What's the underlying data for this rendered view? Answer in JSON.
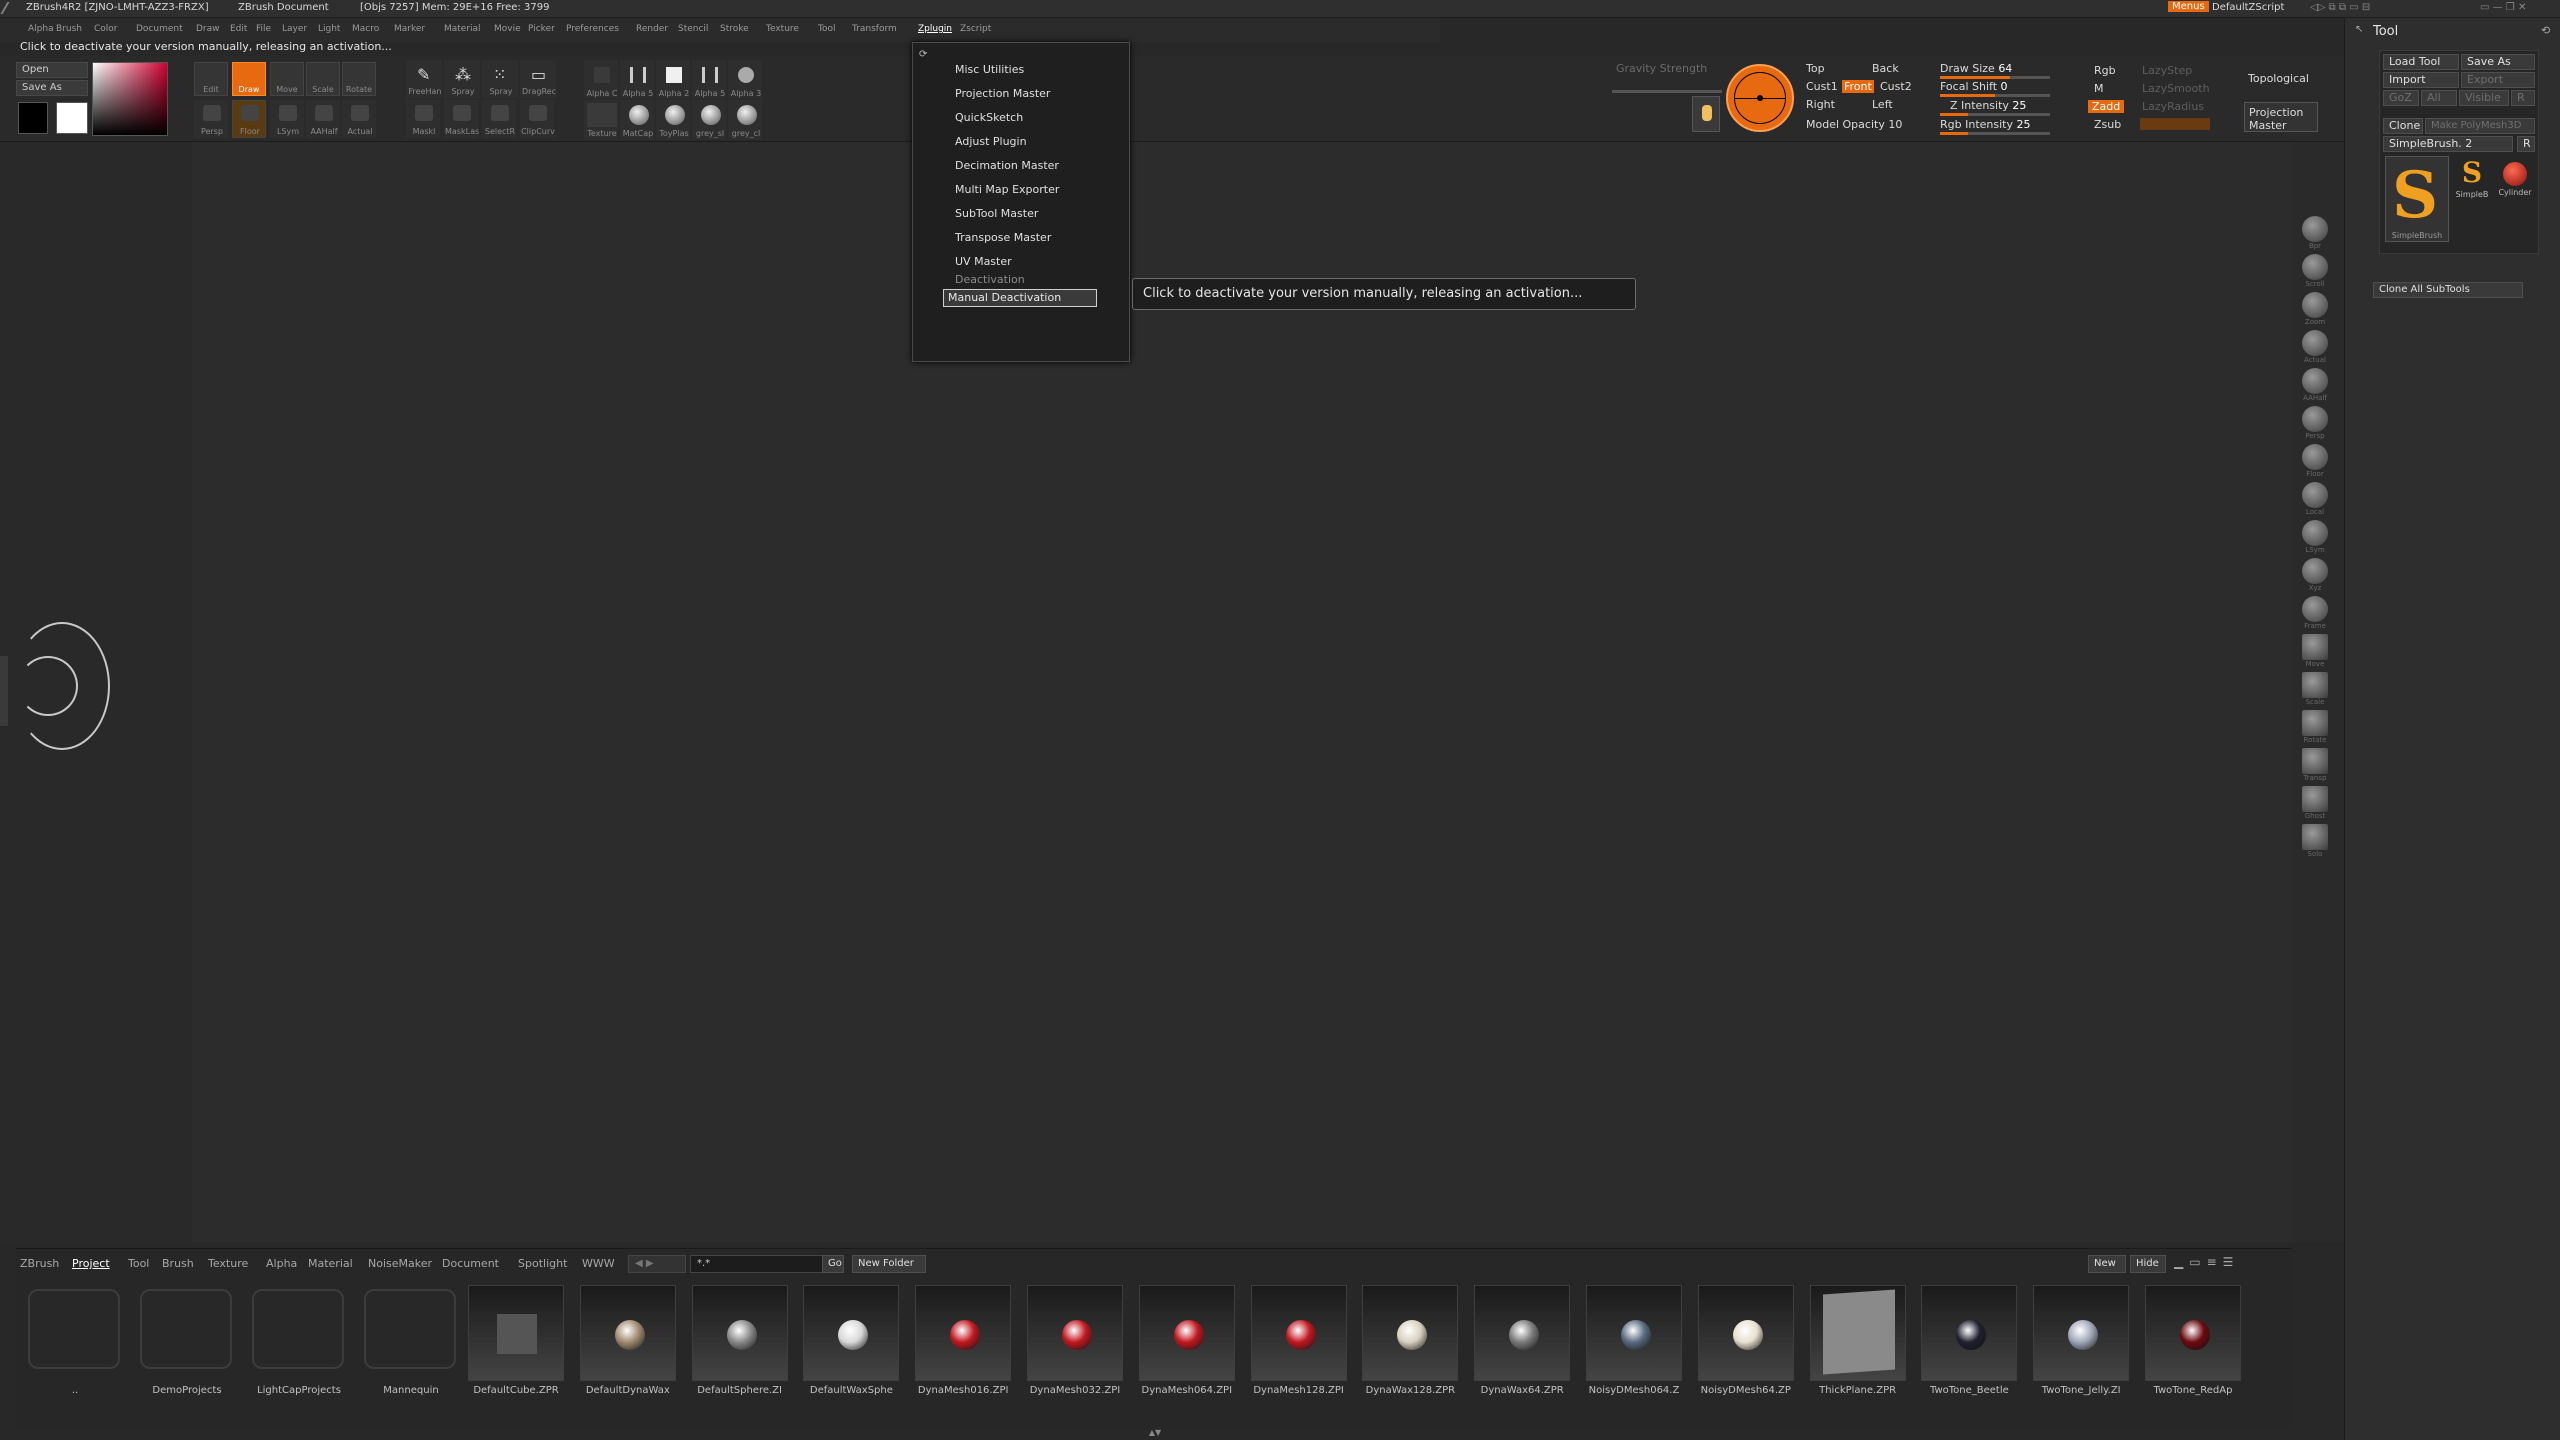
{
  "titlebar": {
    "app": "ZBrush4R2 [ZJNO-LMHT-AZZ3-FRZX]",
    "document": "ZBrush Document",
    "stats": "[Objs 7257]  Mem: 29E+16  Free: 3799",
    "menus_button": "Menus",
    "script_label": "DefaultZScript"
  },
  "menubar": {
    "items": [
      "Alpha",
      "Brush",
      "Color",
      "Document",
      "Draw",
      "Edit",
      "File",
      "Layer",
      "Light",
      "Macro",
      "Marker",
      "Material",
      "Movie",
      "Picker",
      "Preferences",
      "Render",
      "Stencil",
      "Stroke",
      "Texture",
      "Tool",
      "Transform",
      "Zplugin",
      "Zscript"
    ],
    "active": "Zplugin"
  },
  "status_message": "Click to deactivate your version manually, releasing an activation...",
  "shelf": {
    "open_label": "Open",
    "save_as_label": "Save As",
    "draw_labels": [
      "Edit",
      "Draw",
      "Move",
      "Scale",
      "Rotate"
    ],
    "stroke_labels": [
      "FreeHan",
      "Spray",
      "Spray",
      "DragRec"
    ],
    "alpha_labels": [
      "Alpha C",
      "Alpha 5",
      "Alpha 2",
      "Alpha 5",
      "Alpha 3"
    ],
    "lower_labels": [
      "Texture",
      "MatCap",
      "ToyPlas",
      "grey_sl",
      "grey_cl"
    ],
    "mode_labels": [
      "Persp",
      "Floor",
      "LSym",
      "AAHalf",
      "Actual",
      "Maskl",
      "MaskLas",
      "SelectR",
      "ClipCurv"
    ],
    "gravity_label": "Gravity Strength",
    "view_labels": [
      "Top",
      "Back",
      "Cust1",
      "Front",
      "Cust2",
      "Right",
      "Left"
    ],
    "model_opacity": "Model Opacity 10",
    "draw_size": {
      "label": "Draw Size",
      "value": "64",
      "fraction": 0.64
    },
    "focal_shift": {
      "label": "Focal Shift",
      "value": "0",
      "fraction": 0.5
    },
    "z_intensity": {
      "label": "Z Intensity",
      "value": "25",
      "fraction": 0.25
    },
    "rgb_intensity": {
      "label": "Rgb Intensity",
      "value": "25",
      "fraction": 0.25
    },
    "rgb": "Rgb",
    "m": "M",
    "zadd": "Zadd",
    "zsub": "Zsub",
    "lazy_labels": [
      "LazyStep",
      "LazySmooth",
      "LazyRadius"
    ],
    "topological": "Topological",
    "projection_master": "Projection Master"
  },
  "zplugin_menu": {
    "items": [
      "Misc Utilities",
      "Projection Master",
      "QuickSketch",
      "Adjust Plugin",
      "Decimation Master",
      "Multi Map Exporter",
      "SubTool Master",
      "Transpose Master",
      "UV Master"
    ],
    "section": "Deactivation",
    "selected_item": "Manual Deactivation"
  },
  "tooltip": "Click to deactivate your version manually, releasing an activation...",
  "right_panel": {
    "title": "Tool",
    "load_tool": "Load Tool",
    "save_as": "Save As",
    "import": "Import",
    "export": "Export",
    "goz": "GoZ",
    "all": "All",
    "visible": "Visible",
    "r": "R",
    "clone": "Clone",
    "make_polymesh": "Make PolyMesh3D",
    "current_tool": "SimpleBrush. 2",
    "tool_names": [
      "SimpleBrush",
      "SimpleB",
      "Cylinder"
    ],
    "clone_all": "Clone All SubTools"
  },
  "right_strip": {
    "labels": [
      "Bpr",
      "Scroll",
      "Zoom",
      "Actual",
      "AAHalf",
      "Persp",
      "Floor",
      "Local",
      "LSym",
      "Xyz",
      "Frame",
      "Move",
      "Scale",
      "Rotate",
      "Transp",
      "Ghost",
      "Solo"
    ]
  },
  "lightbox": {
    "tabs": [
      "ZBrush",
      "Project",
      "Tool",
      "Brush",
      "Texture",
      "Alpha",
      "Material",
      "NoiseMaker",
      "Document",
      "Spotlight",
      "WWW"
    ],
    "active_tab": "Project",
    "go": "Go",
    "new_folder": "New Folder",
    "search_value": "*.*",
    "new": "New",
    "hide": "Hide",
    "folders": [
      "..",
      "DemoProjects",
      "LightCapProjects",
      "Mannequin"
    ],
    "files": [
      {
        "name": "DefaultCube.ZPR",
        "color": "#555555"
      },
      {
        "name": "DefaultDynaWax",
        "color": "#a08a70"
      },
      {
        "name": "DefaultSphere.ZI",
        "color": "#8a8a8a"
      },
      {
        "name": "DefaultWaxSphe",
        "color": "#d8d8d8"
      },
      {
        "name": "DynaMesh016.ZPI",
        "color": "#c01820"
      },
      {
        "name": "DynaMesh032.ZPI",
        "color": "#c01820"
      },
      {
        "name": "DynaMesh064.ZPI",
        "color": "#c01820"
      },
      {
        "name": "DynaMesh128.ZPI",
        "color": "#c01820"
      },
      {
        "name": "DynaWax128.ZPR",
        "color": "#d8d0c0"
      },
      {
        "name": "DynaWax64.ZPR",
        "color": "#7a7a7a"
      },
      {
        "name": "NoisyDMesh064.Z",
        "color": "#5a6a80"
      },
      {
        "name": "NoisyDMesh64.ZP",
        "color": "#e8e0d0"
      },
      {
        "name": "ThickPlane.ZPR",
        "color": "#8a8a8a"
      },
      {
        "name": "TwoTone_Beetle",
        "color": "#202030"
      },
      {
        "name": "TwoTone_Jelly.ZI",
        "color": "#a0a8b8"
      },
      {
        "name": "TwoTone_RedAp",
        "color": "#6a0a10"
      }
    ]
  },
  "colors": {
    "accent": "#e86a10",
    "background": "#282828",
    "panel": "#2e2e2e"
  }
}
